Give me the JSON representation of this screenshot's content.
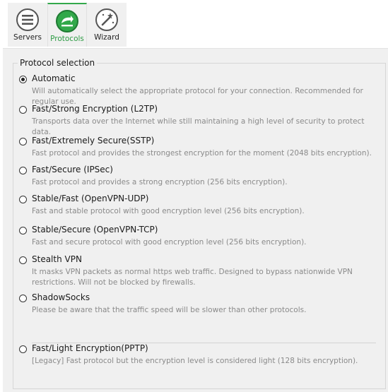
{
  "tabs": [
    {
      "label": "Servers",
      "icon": "servers-list-icon",
      "active": false
    },
    {
      "label": "Protocols",
      "icon": "protocols-icon",
      "active": true
    },
    {
      "label": "Wizard",
      "icon": "wizard-wand-icon",
      "active": false
    }
  ],
  "colors": {
    "accent": "#32a84a",
    "panel_background": "#f0f0f0",
    "description_text": "#8a8a8a"
  },
  "protocol_selection": {
    "title": "Protocol selection",
    "selected": "Automatic",
    "options": [
      {
        "label": "Automatic",
        "description": "Will automatically select the appropriate protocol for your connection. Recommended for regular use.",
        "checked": true
      },
      {
        "label": "Fast/Strong Encryption (L2TP)",
        "description": "Transports data over the Internet while still maintaining a high level of security to protect data.",
        "checked": false
      },
      {
        "label": "Fast/Extremely Secure(SSTP)",
        "description": "Fast protocol and provides the strongest encryption for the moment (2048 bits encryption).",
        "checked": false
      },
      {
        "label": "Fast/Secure (IPSec)",
        "description": "Fast protocol and provides a strong encryption (256 bits encryption).",
        "checked": false
      },
      {
        "label": "Stable/Fast (OpenVPN-UDP)",
        "description": "Fast and stable protocol with good encryption level (256 bits encryption).",
        "checked": false
      },
      {
        "label": "Stable/Secure (OpenVPN-TCP)",
        "description": "Fast and secure protocol with good encryption level (256 bits encryption).",
        "checked": false
      },
      {
        "label": "Stealth VPN",
        "description": "It masks VPN packets as normal https web traffic. Designed to bypass nationwide VPN restrictions. Will not be blocked by firewalls.",
        "checked": false
      },
      {
        "label": "ShadowSocks",
        "description": "Please be aware that the traffic speed will be slower than other protocols.",
        "checked": false
      }
    ],
    "legacy_option": {
      "label": "Fast/Light Encryption(PPTP)",
      "description": "[Legacy] Fast protocol but the encryption level is considered light (128 bits encryption).",
      "checked": false
    }
  }
}
